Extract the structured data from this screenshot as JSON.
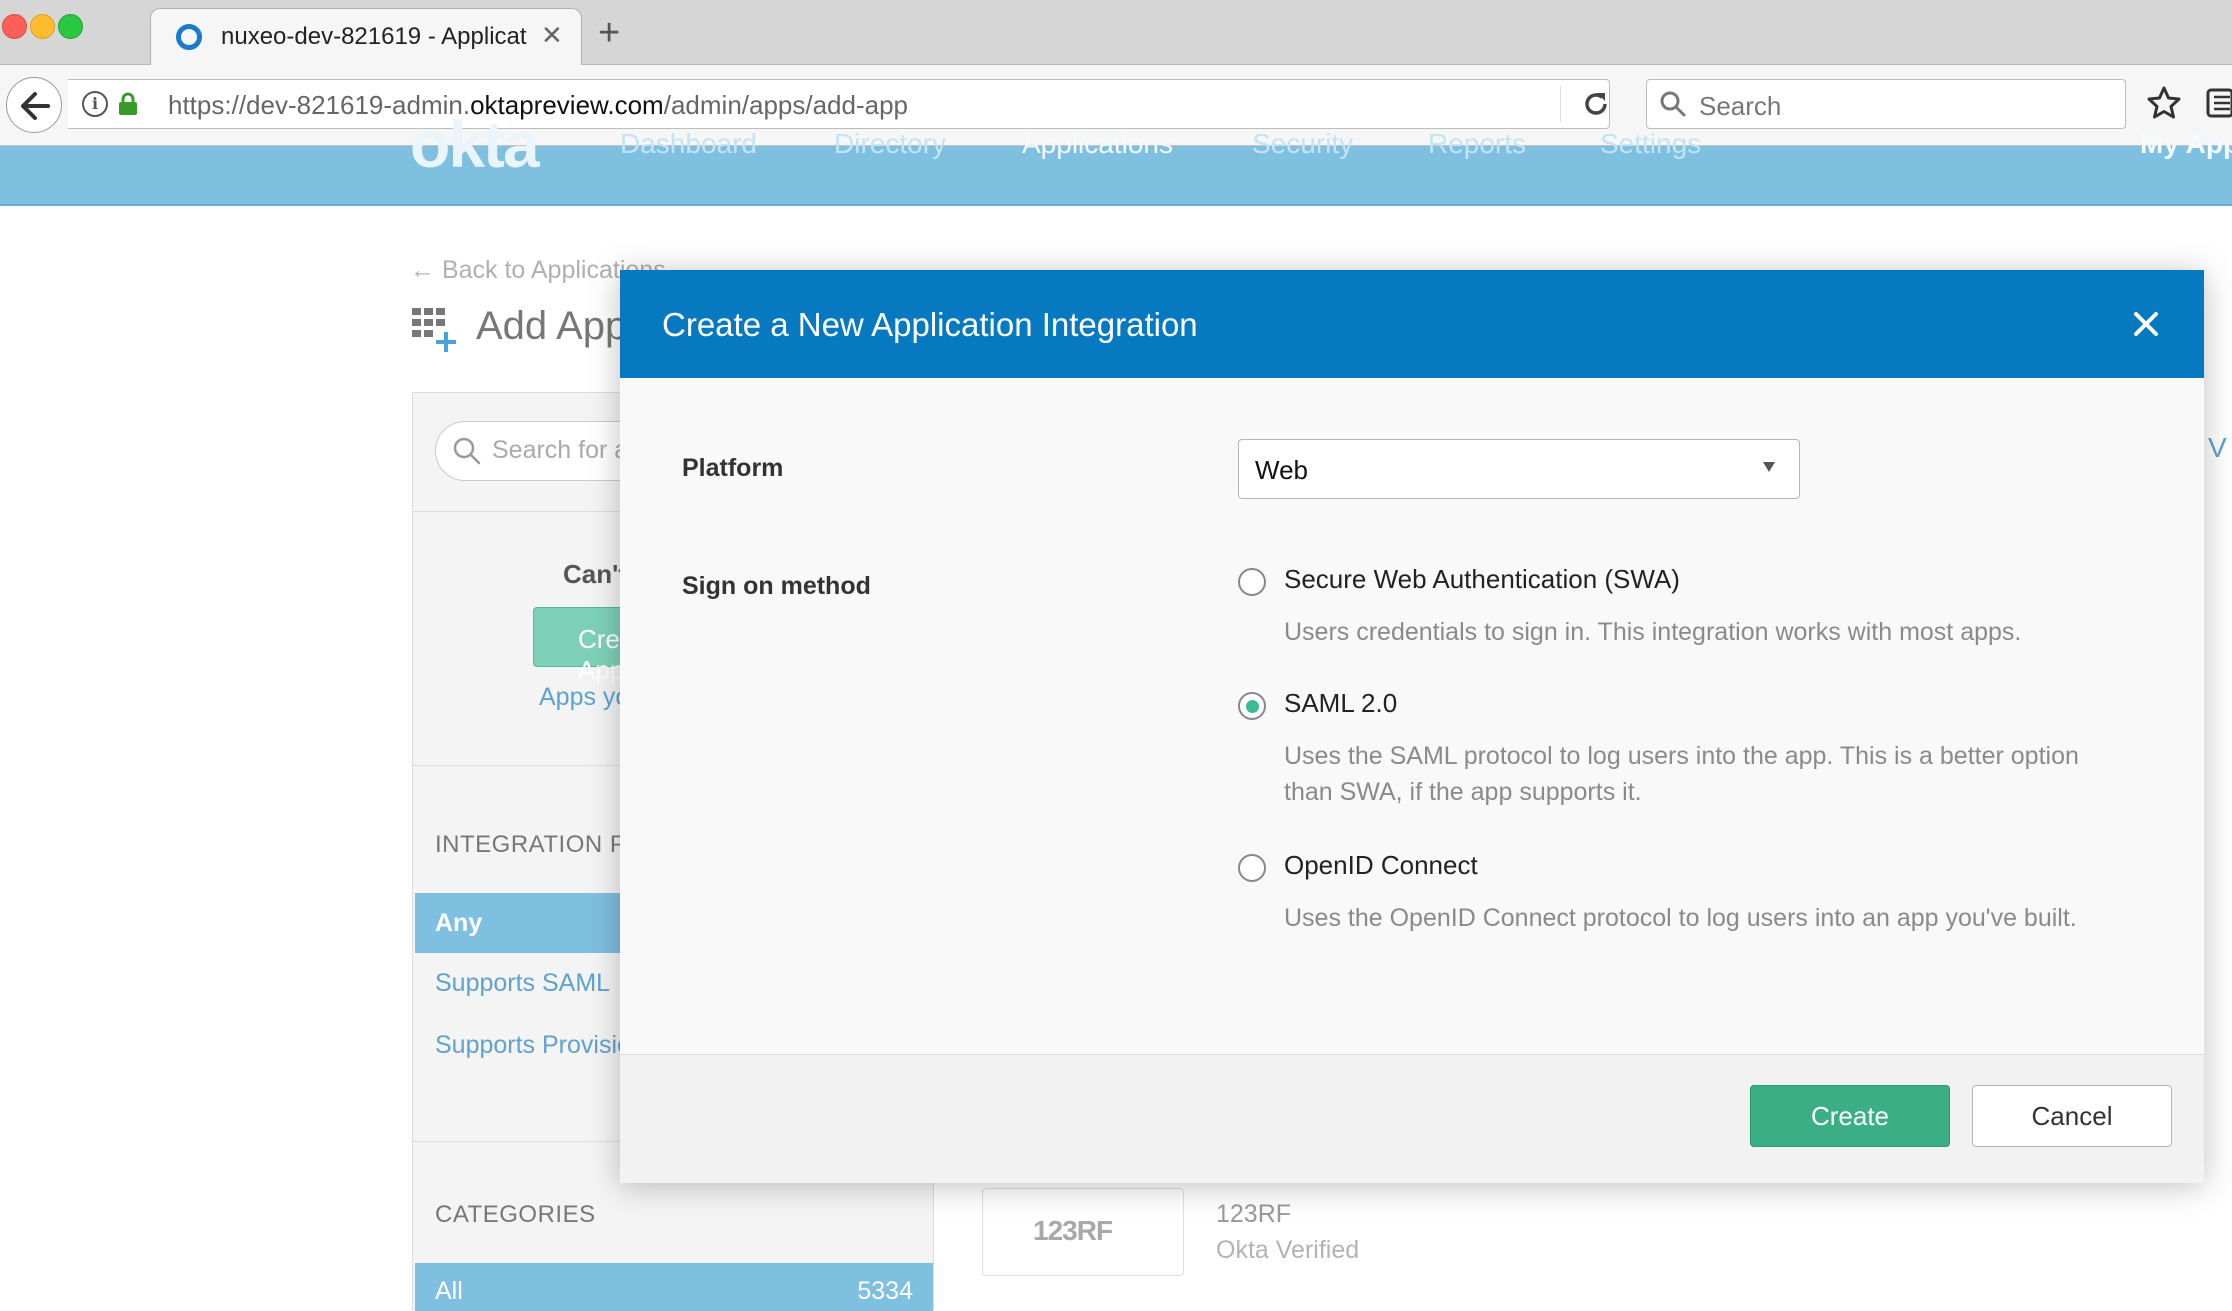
{
  "browser": {
    "tab_title": "nuxeo-dev-821619 - Applicat",
    "url_prefix": "https://dev-821619-admin.",
    "url_domain": "oktapreview.com",
    "url_path": "/admin/apps/add-app",
    "search_placeholder": "Search"
  },
  "okta_nav": {
    "logo": "okta",
    "items": [
      "Dashboard",
      "Directory",
      "Applications",
      "Security",
      "Reports",
      "Settings",
      "My App"
    ]
  },
  "page": {
    "back_link": "← Back to Applications",
    "title": "Add Application",
    "catalog_search_placeholder": "Search for an application",
    "cant_find": "Can't find an app?",
    "create_new_label": "Create New App",
    "apps_you_link": "Apps you created",
    "integration_heading": "INTEGRATION PROPERTIES",
    "filters": [
      "Any",
      "Supports SAML",
      "Supports Provisioning"
    ],
    "categories_heading": "CATEGORIES",
    "category_all": {
      "label": "All",
      "count": "5334"
    },
    "app_result": {
      "logo_text": "123RF",
      "name": "123RF",
      "status": "Okta Verified"
    },
    "right_edge_text": "V"
  },
  "modal": {
    "title": "Create a New Application Integration",
    "platform_label": "Platform",
    "platform_value": "Web",
    "signon_label": "Sign on method",
    "options": [
      {
        "label": "Secure Web Authentication (SWA)",
        "description": "Users credentials to sign in. This integration works with most apps.",
        "selected": false
      },
      {
        "label": "SAML 2.0",
        "description": "Uses the SAML protocol to log users into the app. This is a better option than SWA, if the app supports it.",
        "selected": true
      },
      {
        "label": "OpenID Connect",
        "description": "Uses the OpenID Connect protocol to log users into an app you've built.",
        "selected": false
      }
    ],
    "create_label": "Create",
    "cancel_label": "Cancel"
  },
  "colors": {
    "modal_header": "#0679c0",
    "okta_nav": "#7fbfe0",
    "create_button": "#3aaf86",
    "radio_selected": "#3dbb95"
  }
}
